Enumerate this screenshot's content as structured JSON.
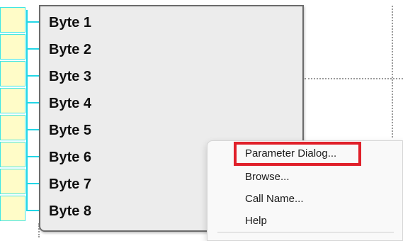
{
  "block": {
    "bytes": [
      "Byte 1",
      "Byte 2",
      "Byte 3",
      "Byte 4",
      "Byte 5",
      "Byte 6",
      "Byte 7",
      "Byte 8"
    ]
  },
  "context_menu": {
    "items": [
      "Parameter Dialog...",
      "Browse...",
      "Call Name...",
      "Help"
    ],
    "highlighted_item": "Parameter Dialog...",
    "highlight_color": "#e0202a"
  },
  "colors": {
    "block_fill": "#ececec",
    "block_border": "#6b6b6b",
    "pin_fill": "#fffcc8",
    "pin_line": "#22d6e6"
  }
}
